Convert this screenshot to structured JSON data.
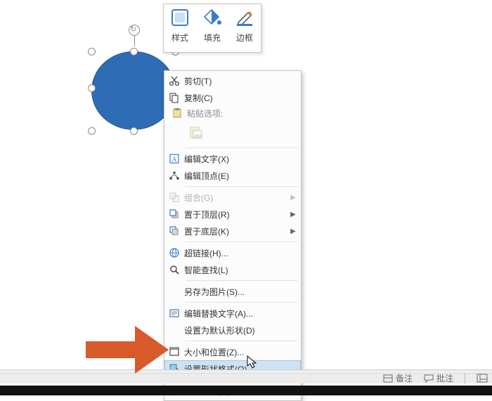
{
  "mini_toolbar": {
    "style": "样式",
    "fill": "填充",
    "outline": "边框"
  },
  "context_menu": {
    "cut": "剪切(T)",
    "copy": "复制(C)",
    "paste_options_header": "粘贴选项:",
    "edit_text": "编辑文字(X)",
    "edit_points": "编辑顶点(E)",
    "group": "组合(G)",
    "bring_front": "置于顶层(R)",
    "send_back": "置于底层(K)",
    "hyperlink": "超链接(H)...",
    "smart_lookup": "智能查找(L)",
    "save_as_picture": "另存为图片(S)...",
    "edit_alt_text": "编辑替换文字(A)...",
    "set_default_shape": "设置为默认形状(D)",
    "size_position": "大小和位置(Z)...",
    "format_shape": "设置形状格式(O)...",
    "new_comment": "新建批注(M)"
  },
  "status_bar": {
    "notes": "备注",
    "comments": "批注"
  }
}
